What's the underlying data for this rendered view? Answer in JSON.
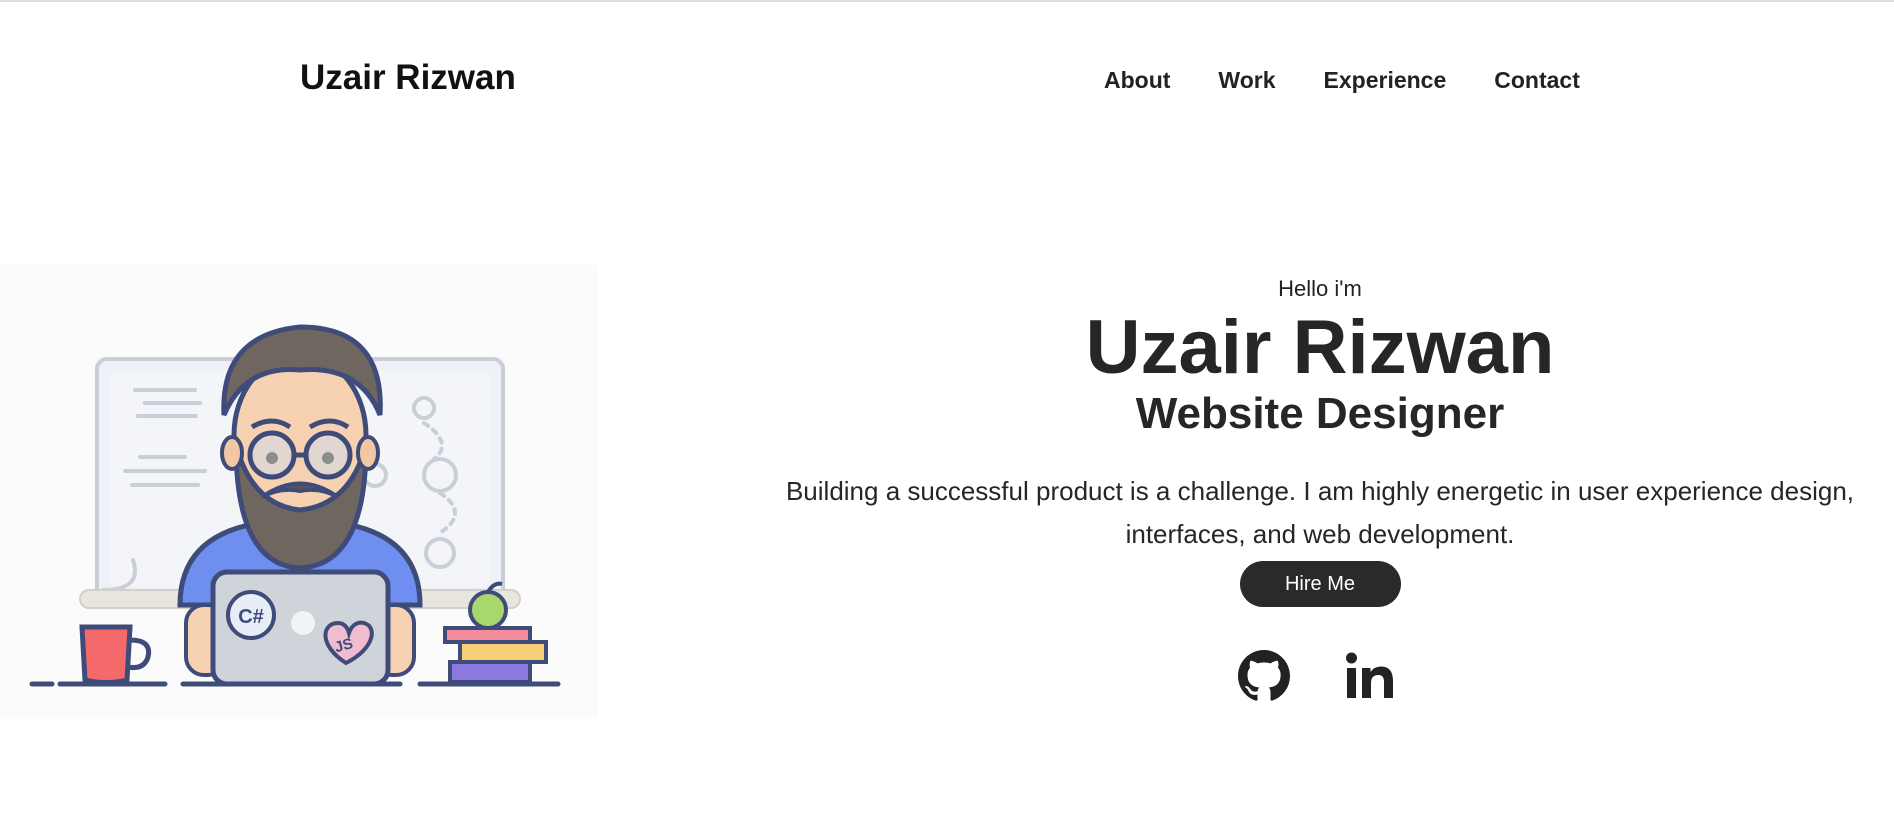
{
  "header": {
    "brand": "Uzair Rizwan",
    "nav": [
      {
        "label": "About"
      },
      {
        "label": "Work"
      },
      {
        "label": "Experience"
      },
      {
        "label": "Contact"
      }
    ]
  },
  "hero": {
    "greeting": "Hello i'm",
    "name": "Uzair Rizwan",
    "role": "Website Designer",
    "description": "Building a successful product is a challenge. I am highly energetic in user experience design, interfaces, and web development.",
    "cta_label": "Hire Me"
  },
  "illustration": {
    "laptop_sticker_1": "C#",
    "laptop_sticker_2": "JS"
  },
  "social": [
    {
      "icon": "github-icon"
    },
    {
      "icon": "linkedin-icon"
    }
  ],
  "colors": {
    "text": "#262626",
    "button_bg": "#2a2a2a",
    "button_text": "#ffffff"
  }
}
